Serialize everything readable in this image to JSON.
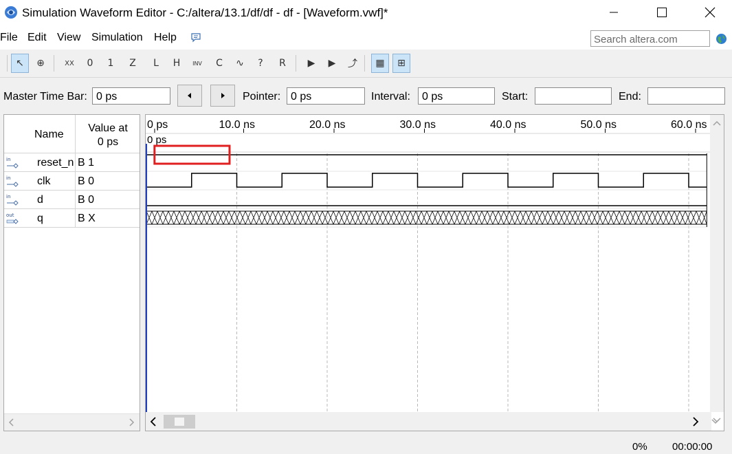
{
  "window": {
    "title": "Simulation Waveform Editor - C:/altera/13.1/df/df - df - [Waveform.vwf]*"
  },
  "menu": {
    "items": [
      "File",
      "Edit",
      "View",
      "Simulation",
      "Help"
    ],
    "search_placeholder": "Search altera.com"
  },
  "toolbar": {
    "tools": [
      {
        "name": "selection-tool-icon",
        "glyph": "↖",
        "active": true
      },
      {
        "name": "zoom-tool-icon",
        "glyph": "⊕",
        "active": false
      },
      {
        "name": "unknown-value-icon",
        "glyph": "XX",
        "active": false
      },
      {
        "name": "force-low-icon",
        "glyph": "0",
        "active": false
      },
      {
        "name": "force-high-icon",
        "glyph": "1",
        "active": false
      },
      {
        "name": "high-impedance-icon",
        "glyph": "Z",
        "active": false
      },
      {
        "name": "weak-low-icon",
        "glyph": "L",
        "active": false
      },
      {
        "name": "weak-high-icon",
        "glyph": "H",
        "active": false
      },
      {
        "name": "invert-icon",
        "glyph": "INV",
        "active": false
      },
      {
        "name": "count-value-icon",
        "glyph": "C",
        "active": false
      },
      {
        "name": "clock-value-icon",
        "glyph": "∿",
        "active": false
      },
      {
        "name": "arbitrary-value-icon",
        "glyph": "?",
        "active": false
      },
      {
        "name": "random-value-icon",
        "glyph": "R",
        "active": false
      },
      {
        "name": "run-functional-simulation-icon",
        "glyph": "▶",
        "active": false
      },
      {
        "name": "run-timing-simulation-icon",
        "glyph": "▶",
        "active": false
      },
      {
        "name": "generate-netlist-icon",
        "glyph": "⤴",
        "active": false
      },
      {
        "name": "snap-to-grid-icon",
        "glyph": "▦",
        "active": true
      },
      {
        "name": "grid-view-icon",
        "glyph": "⊞",
        "active": true
      }
    ]
  },
  "timebar": {
    "master_label": "Master Time Bar:",
    "master_value": "0 ps",
    "pointer_label": "Pointer:",
    "pointer_value": "0 ps",
    "interval_label": "Interval:",
    "interval_value": "0 ps",
    "start_label": "Start:",
    "start_value": "",
    "end_label": "End:",
    "end_value": ""
  },
  "signals_panel": {
    "name_header": "Name",
    "value_header_line1": "Value at",
    "value_header_line2": "0 ps",
    "signals": [
      {
        "type": "in",
        "name": "reset_n",
        "value": "B 1"
      },
      {
        "type": "in",
        "name": "clk",
        "value": "B 0"
      },
      {
        "type": "in",
        "name": "d",
        "value": "B 0"
      },
      {
        "type": "out",
        "name": "q",
        "value": "B X"
      }
    ]
  },
  "waveform": {
    "time_labels": [
      "0 ps",
      "10.0 ns",
      "20.0 ns",
      "30.0 ns",
      "40.0 ns",
      "50.0 ns",
      "60.0 ns"
    ],
    "pointer_label": "0 ps",
    "clock_period_ns": 10,
    "clock_start_level": 0,
    "clock_first_rise_ns": 5,
    "view_end_ns": 62,
    "reset_n_level": 1,
    "d_level": 0,
    "q_state": "unknown",
    "selection_start_ns": 0.9,
    "selection_end_ns": 9.2
  },
  "status": {
    "progress": "0%",
    "elapsed": "00:00:00"
  },
  "colors": {
    "selection_box": "#e02020",
    "time_cursor": "#1f3fbf",
    "grid_line": "#b8b8b8"
  }
}
